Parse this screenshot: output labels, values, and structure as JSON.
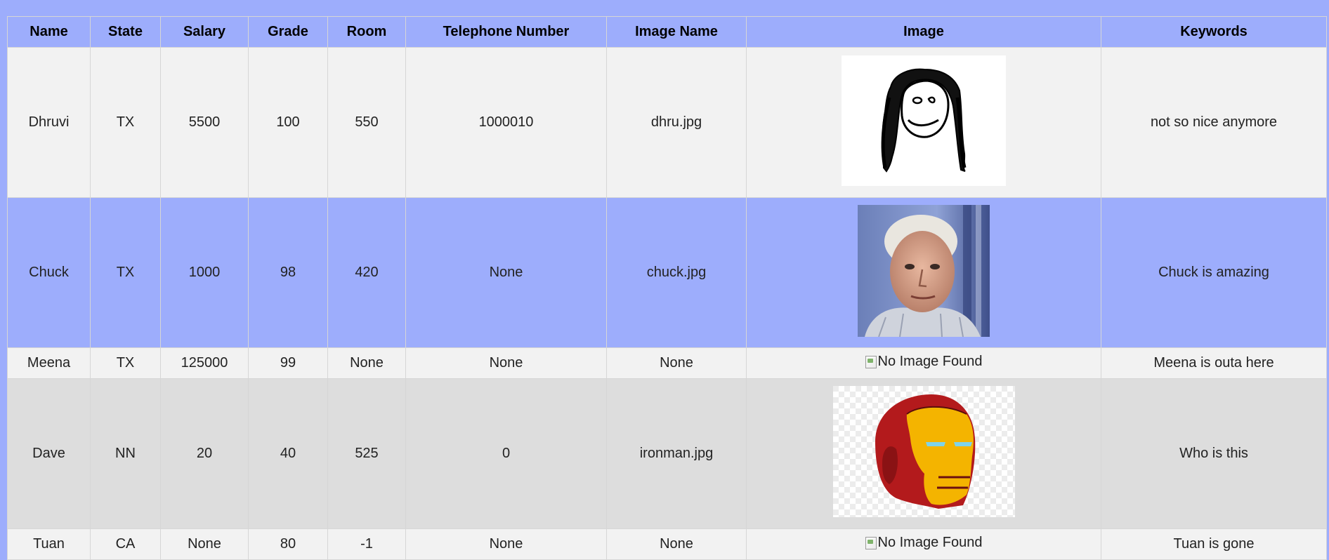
{
  "table": {
    "headers": [
      "Name",
      "State",
      "Salary",
      "Grade",
      "Room",
      "Telephone Number",
      "Image Name",
      "Image",
      "Keywords"
    ],
    "rows": [
      {
        "name": "Dhruvi",
        "state": "TX",
        "salary": "5500",
        "grade": "100",
        "room": "550",
        "telephone": "1000010",
        "image_name": "dhru.jpg",
        "image": "sketch-face-drawing",
        "keywords": "not so nice anymore"
      },
      {
        "name": "Chuck",
        "state": "TX",
        "salary": "1000",
        "grade": "98",
        "room": "420",
        "telephone": "None",
        "image_name": "chuck.jpg",
        "image": "portrait-photo-older-man",
        "keywords": "Chuck is amazing"
      },
      {
        "name": "Meena",
        "state": "TX",
        "salary": "125000",
        "grade": "99",
        "room": "None",
        "telephone": "None",
        "image_name": "None",
        "image_alt": "No Image Found",
        "keywords": "Meena is outa here"
      },
      {
        "name": "Dave",
        "state": "NN",
        "salary": "20",
        "grade": "40",
        "room": "525",
        "telephone": "0",
        "image_name": "ironman.jpg",
        "image": "ironman-helmet",
        "keywords": "Who is this"
      },
      {
        "name": "Tuan",
        "state": "CA",
        "salary": "None",
        "grade": "80",
        "room": "-1",
        "telephone": "None",
        "image_name": "None",
        "image_alt": "No Image Found",
        "keywords": "Tuan is gone"
      }
    ]
  },
  "colors": {
    "page_background": "#9dadfc",
    "header_background": "#9dadfc",
    "row_light": "#f2f2f2",
    "row_blue": "#9dadfc",
    "row_grey": "#dddddd"
  }
}
